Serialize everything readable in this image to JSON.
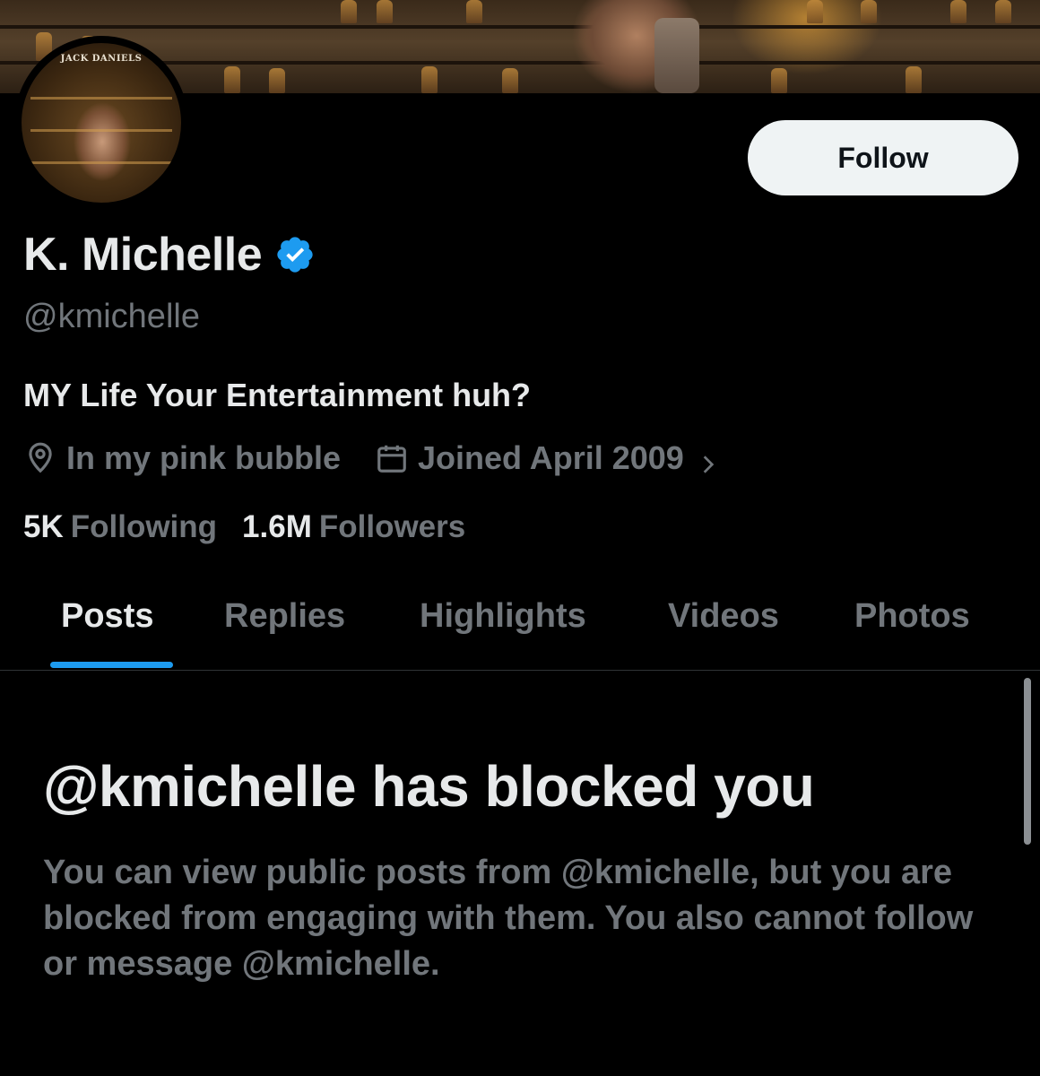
{
  "banner": {
    "description_icon": "banner-photo"
  },
  "avatar": {
    "logo_text": "JACK DANIELS"
  },
  "profile": {
    "follow_label": "Follow",
    "display_name": "K. Michelle",
    "verified_icon": "verified-badge-icon",
    "handle": "@kmichelle",
    "bio": "MY Life Your Entertainment huh?",
    "location": "In my pink bubble",
    "joined": "Joined April 2009",
    "following_count": "5K",
    "following_label": "Following",
    "followers_count": "1.6M",
    "followers_label": "Followers"
  },
  "tabs": [
    {
      "label": "Posts",
      "active": true
    },
    {
      "label": "Replies",
      "active": false
    },
    {
      "label": "Highlights",
      "active": false
    },
    {
      "label": "Videos",
      "active": false
    },
    {
      "label": "Photos",
      "active": false
    }
  ],
  "blocked": {
    "title": "@kmichelle has blocked you",
    "body": "You can view public posts from @kmichelle, but you are blocked from engaging with them. You also cannot follow or message @kmichelle."
  },
  "colors": {
    "background": "#000000",
    "primary_text": "#e7e9ea",
    "secondary_text": "#71767b",
    "accent": "#1d9bf0",
    "follow_bg": "#eff3f4"
  }
}
